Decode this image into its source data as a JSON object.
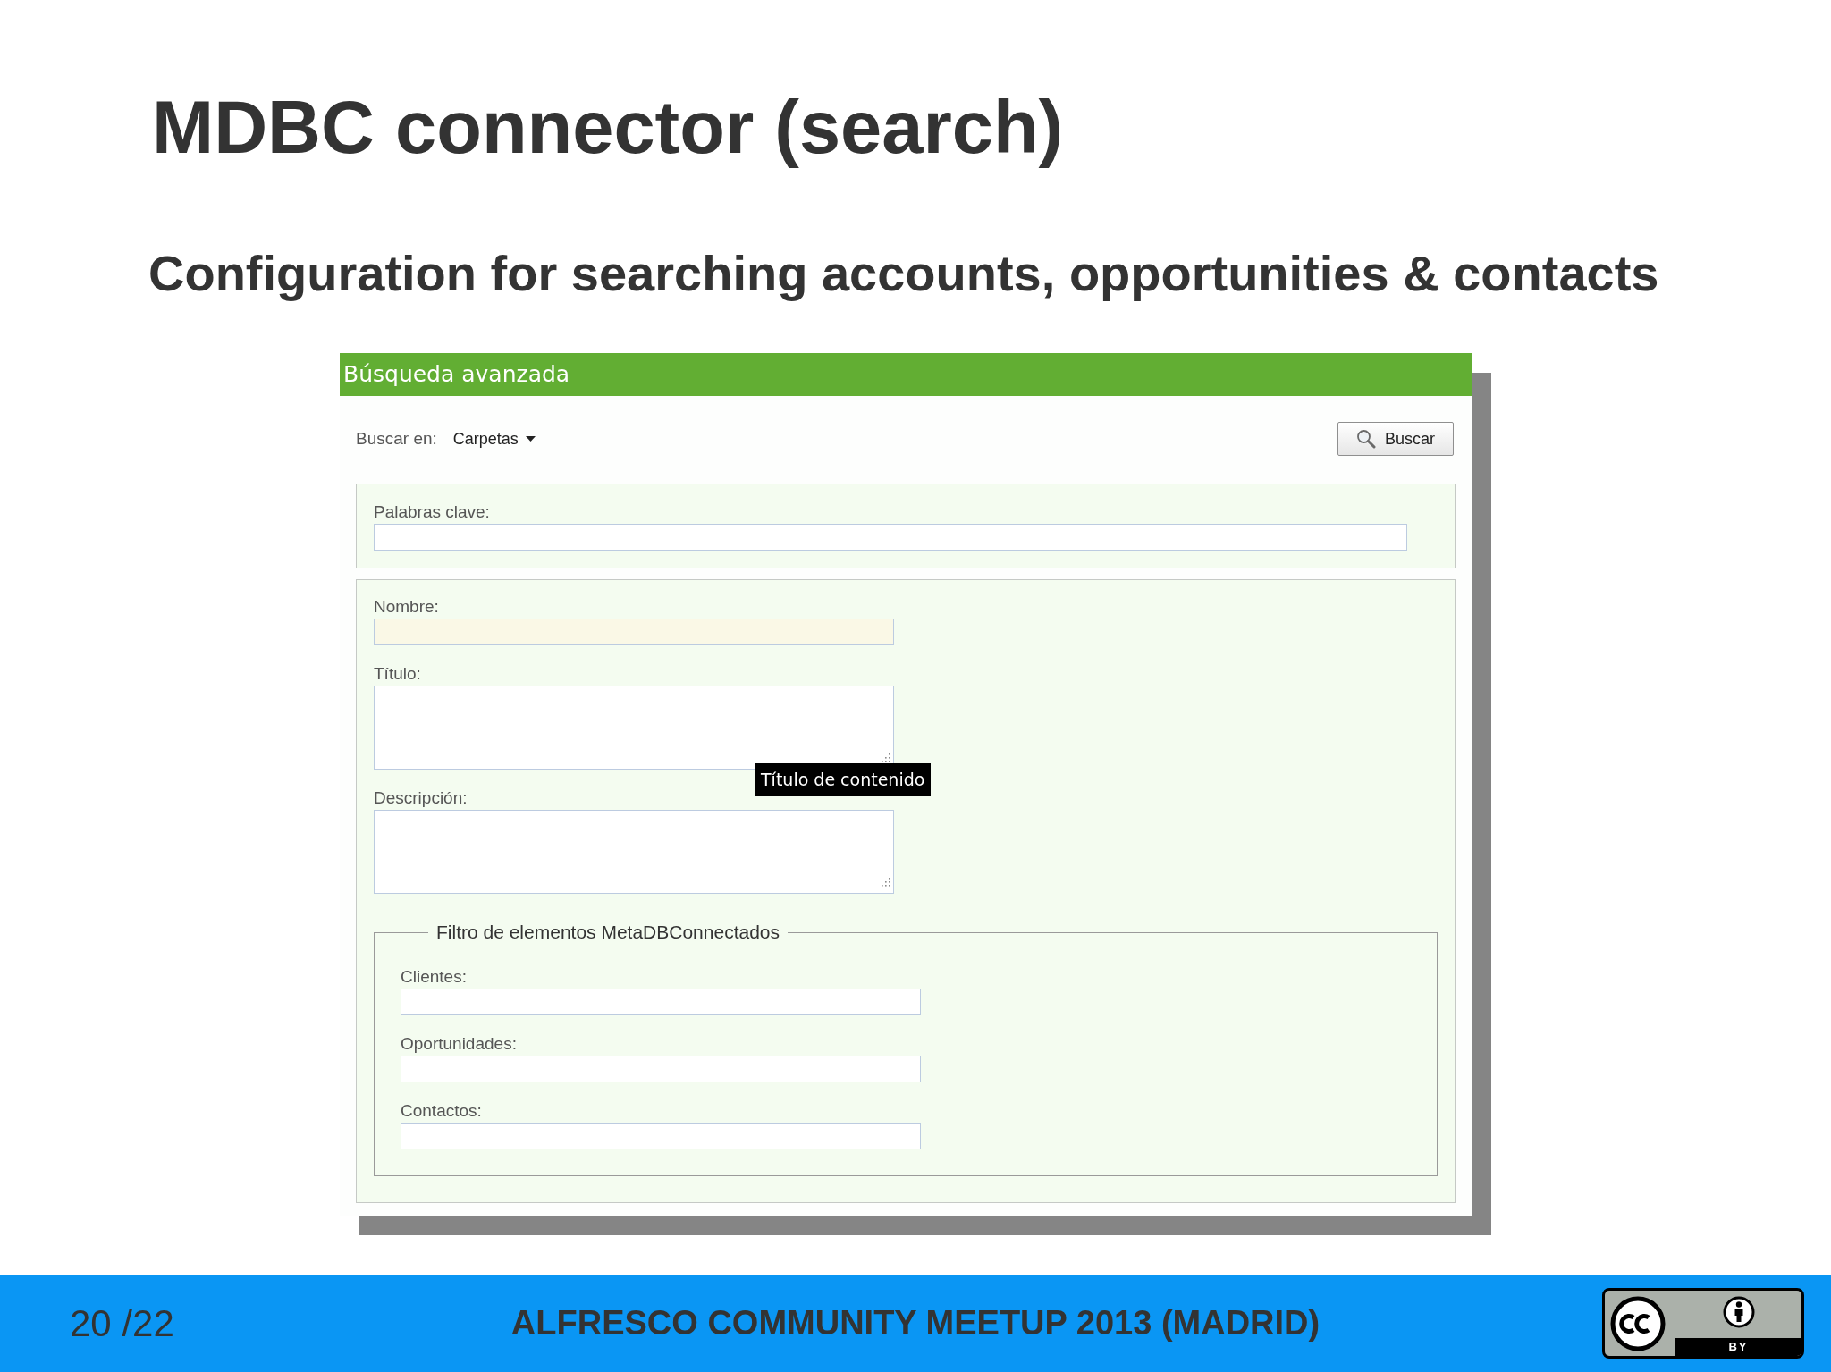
{
  "slide": {
    "title": "MDBC connector (search)",
    "subtitle": "Configuration for searching accounts, opportunities & contacts"
  },
  "search_panel": {
    "header": "Búsqueda avanzada",
    "scope": {
      "label": "Buscar en:",
      "value": "Carpetas"
    },
    "search_button": {
      "label": "Buscar"
    },
    "keywords": {
      "label": "Palabras clave:"
    },
    "fields": [
      {
        "kind": "input",
        "label": "Nombre:",
        "highlighted": true
      },
      {
        "kind": "textarea",
        "label": "Título:",
        "highlighted": false,
        "tooltip": "Título de contenido"
      },
      {
        "kind": "textarea",
        "label": "Descripción:",
        "highlighted": false
      }
    ],
    "filter": {
      "legend": "Filtro de elementos MetaDBConnectados",
      "fields": [
        {
          "kind": "input",
          "label": "Clientes:",
          "highlighted": false
        },
        {
          "kind": "input",
          "label": "Oportunidades:",
          "highlighted": false
        },
        {
          "kind": "input",
          "label": "Contactos:",
          "highlighted": false
        }
      ]
    }
  },
  "footer": {
    "page": "20 /22",
    "event": "ALFRESCO COMMUNITY MEETUP 2013 (MADRID)",
    "license": {
      "label": "BY"
    }
  }
}
